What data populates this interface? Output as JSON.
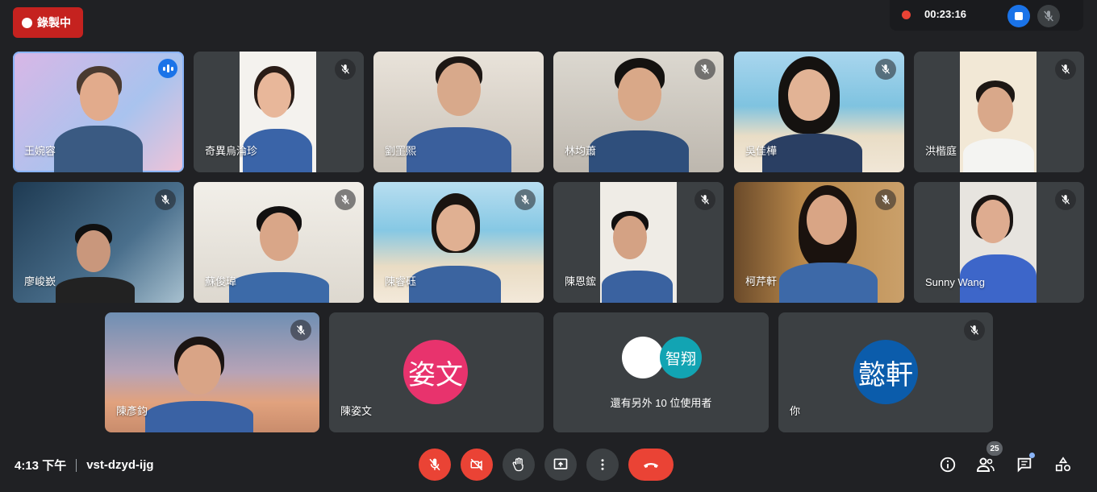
{
  "recording": {
    "label": "錄製中"
  },
  "topbar": {
    "timer": "00:23:16"
  },
  "participants": [
    {
      "name": "王婉容",
      "muted": false,
      "speaking": true
    },
    {
      "name": "奇異烏淪珍",
      "muted": true
    },
    {
      "name": "劉罣熙",
      "muted": false
    },
    {
      "name": "林均蕭",
      "muted": true
    },
    {
      "name": "吳佳樺",
      "muted": true
    },
    {
      "name": "洪楷庭",
      "muted": true
    },
    {
      "name": "廖峻嶔",
      "muted": true
    },
    {
      "name": "蘇俊瑋",
      "muted": true
    },
    {
      "name": "陳睿砡",
      "muted": true
    },
    {
      "name": "陳恩鋐",
      "muted": true
    },
    {
      "name": "柯芹軒",
      "muted": true
    },
    {
      "name": "Sunny Wang",
      "muted": true
    },
    {
      "name": "陳彥鈞",
      "muted": true
    },
    {
      "name": "陳姿文",
      "muted": false,
      "avatar_text": "姿文",
      "avatar_color": "#e8336d"
    },
    {
      "name": "你",
      "muted": true,
      "avatar_text": "懿軒",
      "avatar_color": "#0b5cab"
    }
  ],
  "others": {
    "label": "還有另外 10 位使用者",
    "avatar_text": "智翔",
    "avatar_color": "#12a4b3"
  },
  "meeting": {
    "time": "4:13 下午",
    "code": "vst-dzyd-ijg"
  },
  "people_count": "25",
  "colors": {
    "accent": "#1a73e8",
    "danger": "#ea4335",
    "tile": "#3c4043",
    "background": "#202124"
  }
}
